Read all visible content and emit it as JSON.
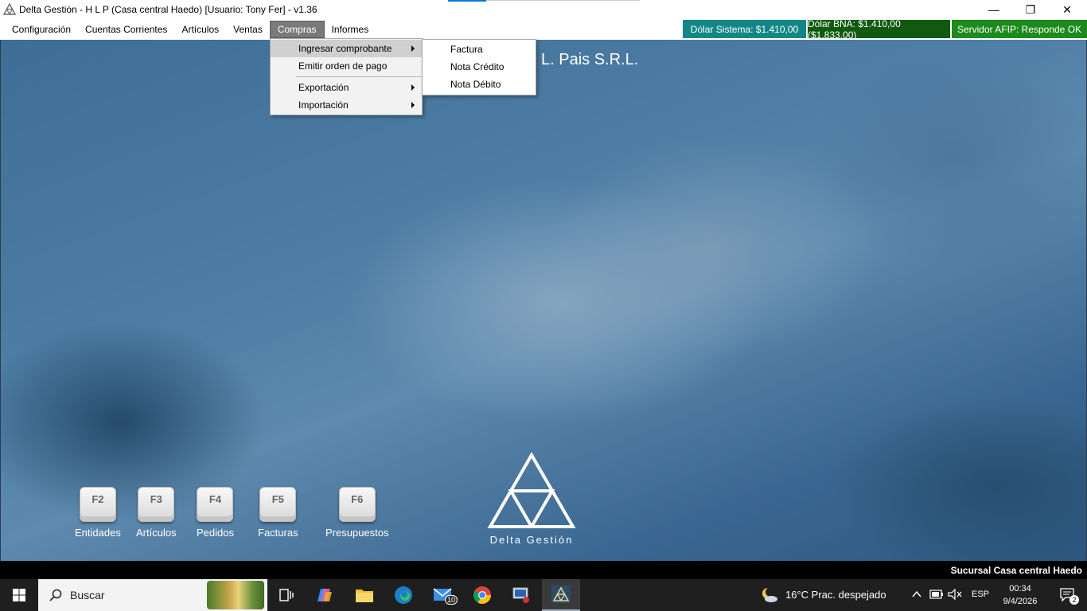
{
  "window": {
    "title": "Delta Gestión - H L P (Casa central Haedo) [Usuario: Tony Fer] - v1.36",
    "minimize_symbol": "—",
    "restore_symbol": "❐",
    "close_symbol": "✕"
  },
  "menubar": {
    "items": [
      {
        "label": "Configuración"
      },
      {
        "label": "Cuentas Corrientes"
      },
      {
        "label": "Artículos"
      },
      {
        "label": "Ventas"
      },
      {
        "label": "Compras"
      },
      {
        "label": "Informes"
      }
    ]
  },
  "status": {
    "dolar_sistema": "Dólar Sistema: $1.410,00",
    "dolar_bna": "Dólar BNA: $1.410,00 ($1.833,00)",
    "afip": "Servidor AFIP:  Responde OK",
    "colors": {
      "dolar_sistema": "#138787",
      "dolar_bna": "#0f5a0f",
      "afip": "#1c8a1c"
    }
  },
  "compras_menu": {
    "items": [
      {
        "label": "Ingresar comprobante"
      },
      {
        "label": "Emitir orden de pago"
      },
      {
        "label": "Exportación"
      },
      {
        "label": "Importación"
      }
    ]
  },
  "comprobante_submenu": {
    "items": [
      {
        "label": "Factura"
      },
      {
        "label": "Nota Crédito"
      },
      {
        "label": "Nota Débito"
      }
    ]
  },
  "desktop": {
    "company": "L. Pais S.R.L.",
    "brand": "Delta Gestión",
    "shortcuts": [
      {
        "key": "F2",
        "label": "Entidades"
      },
      {
        "key": "F3",
        "label": "Artículos"
      },
      {
        "key": "F4",
        "label": "Pedidos"
      },
      {
        "key": "F5",
        "label": "Facturas"
      },
      {
        "key": "F6",
        "label": "Presupuestos"
      }
    ]
  },
  "statusbar": {
    "sucursal": "Sucursal Casa central Haedo"
  },
  "taskbar": {
    "search_placeholder": "Buscar",
    "mail_badge": "10",
    "weather": "16°C  Prac. despejado",
    "language": "ESP",
    "time": "00:34",
    "date": "9/4/2026",
    "notifications": "2"
  }
}
